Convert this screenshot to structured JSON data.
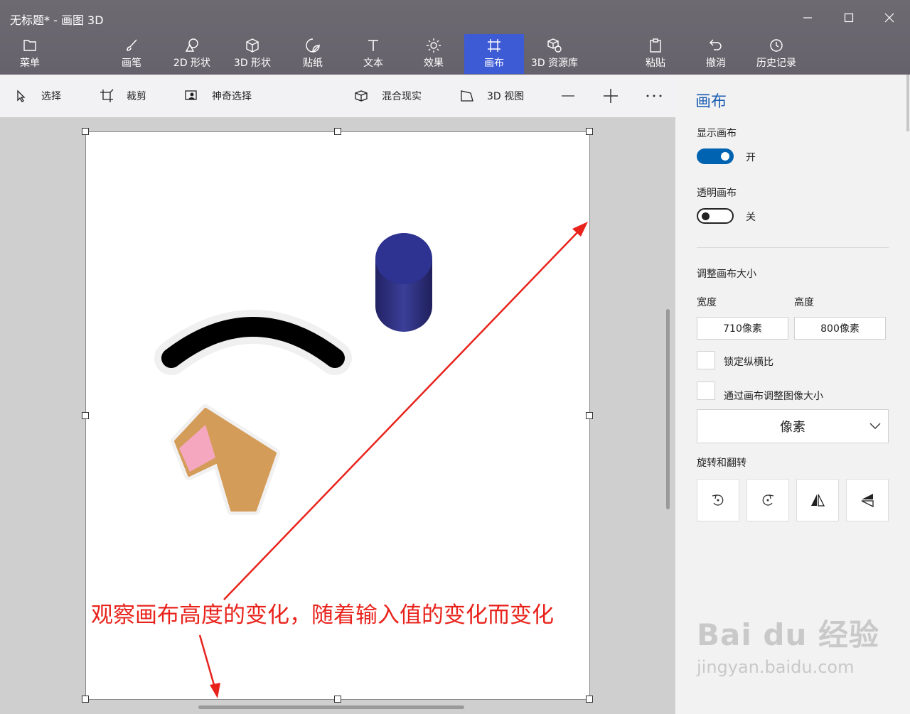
{
  "window": {
    "title": "无标题* - 画图 3D"
  },
  "menu": {
    "label": "菜单"
  },
  "toolbar": {
    "items": [
      {
        "label": "画笔"
      },
      {
        "label": "2D 形状"
      },
      {
        "label": "3D 形状"
      },
      {
        "label": "贴纸"
      },
      {
        "label": "文本"
      },
      {
        "label": "效果"
      },
      {
        "label": "画布"
      },
      {
        "label": "3D 资源库"
      }
    ],
    "paste": "粘贴",
    "undo": "撤消",
    "history": "历史记录"
  },
  "subtoolbar": {
    "select": "选择",
    "crop": "裁剪",
    "magic_select": "神奇选择",
    "mixed_reality": "混合现实",
    "view_3d": "3D 视图"
  },
  "panel": {
    "title": "画布",
    "show_canvas": {
      "label": "显示画布",
      "state": "开",
      "on": true
    },
    "transparent_canvas": {
      "label": "透明画布",
      "state": "关",
      "on": false
    },
    "resize_title": "调整画布大小",
    "width_label": "宽度",
    "height_label": "高度",
    "width_value": "710像素",
    "height_value": "800像素",
    "lock_aspect": "锁定纵横比",
    "resize_image": "通过画布调整图像大小",
    "unit": "像素",
    "rotate_title": "旋转和翻转"
  },
  "annotation": {
    "text": "观察画布高度的变化，随着输入值的变化而变化",
    "color": "#e8231c"
  },
  "watermark": {
    "logo": "Bai du 经验",
    "url": "jingyan.baidu.com"
  },
  "colors": {
    "accent": "#3e5bd6",
    "toggle_on": "#0063b1",
    "titlebar": "#6a666e"
  }
}
